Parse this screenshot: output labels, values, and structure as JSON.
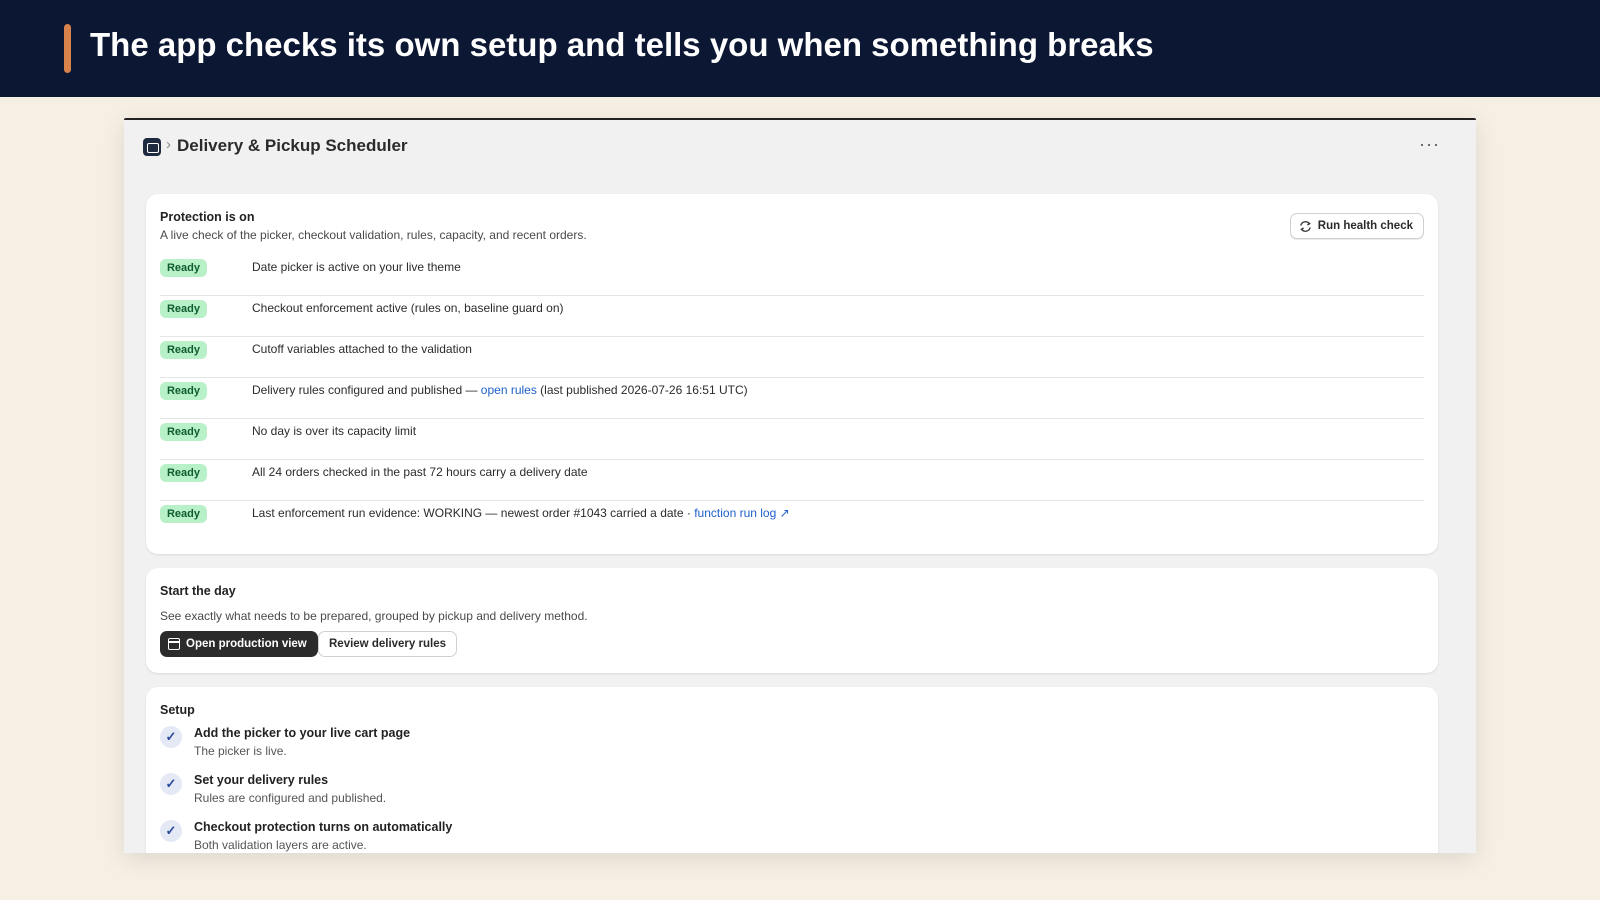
{
  "banner": {
    "title": "The app checks its own setup and tells you when something breaks"
  },
  "app": {
    "breadcrumb_separator": "›",
    "title": "Delivery & Pickup Scheduler",
    "more_label": "···"
  },
  "health": {
    "title": "Protection is on",
    "subtitle": "A live check of the picker, checkout validation, rules, capacity, and recent orders.",
    "run_button": "Run health check",
    "checks": [
      {
        "status": "Ready",
        "text": "Date picker is active on your live theme"
      },
      {
        "status": "Ready",
        "text": "Checkout enforcement active (rules on, baseline guard on)"
      },
      {
        "status": "Ready",
        "text": "Cutoff variables attached to the validation"
      },
      {
        "status": "Ready",
        "text_before": "Delivery rules configured and published — ",
        "link": "open rules",
        "text_after": " (last published 2026-07-26 16:51 UTC)"
      },
      {
        "status": "Ready",
        "text": "No day is over its capacity limit"
      },
      {
        "status": "Ready",
        "text": "All 24 orders checked in the past 72 hours carry a delivery date"
      },
      {
        "status": "Ready",
        "text_before": "Last enforcement run evidence: WORKING — newest order #1043 carried a date · ",
        "link": "function run log ↗"
      }
    ]
  },
  "start": {
    "title": "Start the day",
    "subtitle": "See exactly what needs to be prepared, grouped by pickup and delivery method.",
    "primary_button": "Open production view",
    "secondary_button": "Review delivery rules"
  },
  "setup": {
    "title": "Setup",
    "check_glyph": "✓",
    "steps": [
      {
        "title": "Add the picker to your live cart page",
        "desc": "The picker is live."
      },
      {
        "title": "Set your delivery rules",
        "desc": "Rules are configured and published."
      },
      {
        "title": "Checkout protection turns on automatically",
        "desc": "Both validation layers are active."
      }
    ]
  }
}
